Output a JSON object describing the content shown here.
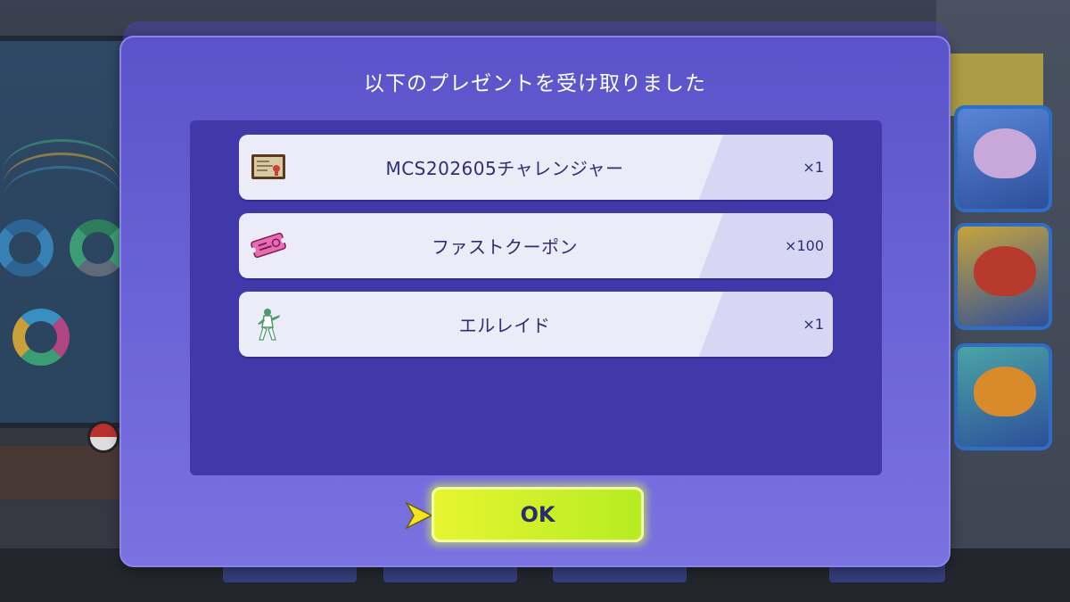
{
  "dialog": {
    "title": "以下のプレゼントを受け取りました",
    "items": [
      {
        "name": "MCS202605チャレンジャー",
        "quantity": "×1",
        "icon": "certificate-icon"
      },
      {
        "name": "ファストクーポン",
        "quantity": "×100",
        "icon": "coupon-ticket-icon"
      },
      {
        "name": "エルレイド",
        "quantity": "×1",
        "icon": "pokemon-gallade-icon"
      }
    ],
    "ok_label": "OK"
  },
  "colors": {
    "dialog_bg": "#5a53c9",
    "panel_bg": "#4138a9",
    "item_bg": "#ebecf7",
    "item_text": "#2d2f6e",
    "ok_button": "#c8ef28"
  }
}
